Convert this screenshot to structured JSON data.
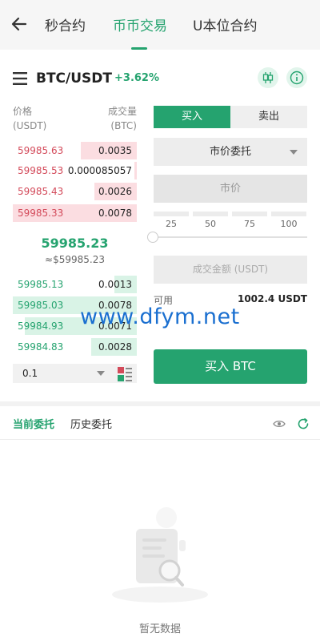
{
  "nav": {
    "tabs": [
      {
        "label": "秒合约"
      },
      {
        "label": "币币交易"
      },
      {
        "label": "U本位合约"
      }
    ],
    "active_tab": 1
  },
  "pair": {
    "symbol": "BTC/USDT",
    "change": "+3.62%"
  },
  "orderbook": {
    "price_header": "价格",
    "price_unit": "(USDT)",
    "qty_header": "成交量",
    "qty_unit": "(BTC)",
    "asks": [
      {
        "price": "59985.63",
        "qty": "0.0035",
        "depth": 0.45
      },
      {
        "price": "59985.53",
        "qty": "0.000085057",
        "depth": 0.02
      },
      {
        "price": "59985.43",
        "qty": "0.0026",
        "depth": 0.34
      },
      {
        "price": "59985.33",
        "qty": "0.0078",
        "depth": 1.0
      }
    ],
    "last_price": "59985.23",
    "last_price_fiat": "≈$59985.23",
    "bids": [
      {
        "price": "59985.13",
        "qty": "0.0013",
        "depth": 0.18
      },
      {
        "price": "59985.03",
        "qty": "0.0078",
        "depth": 1.0
      },
      {
        "price": "59984.93",
        "qty": "0.0071",
        "depth": 0.9
      },
      {
        "price": "59984.83",
        "qty": "0.0028",
        "depth": 0.37
      }
    ],
    "depth_value": "0.1"
  },
  "form": {
    "buy_label": "买入",
    "sell_label": "卖出",
    "order_type": "市价委托",
    "price_placeholder": "市价",
    "percents": [
      "25",
      "50",
      "75",
      "100"
    ],
    "slider_value": 0,
    "amount_placeholder": "成交金额 (USDT)",
    "available_label": "可用",
    "available_value": "1002.4 USDT",
    "submit_label": "买入 BTC"
  },
  "watermark": "www.dfym.net",
  "orders": {
    "tabs": [
      {
        "label": "当前委托"
      },
      {
        "label": "历史委托"
      }
    ],
    "empty_text": "暂无数据"
  },
  "colors": {
    "accent": "#25a36f",
    "ask": "#d34a5a",
    "ask_bg": "#fbdde1",
    "bid_bg": "#d9f3e6"
  }
}
